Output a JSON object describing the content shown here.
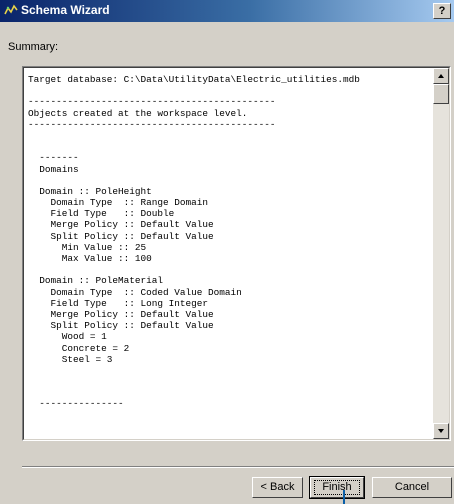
{
  "window": {
    "title": "Schema Wizard",
    "help_label": "?"
  },
  "summary_label": "Summary:",
  "summary_lines": [
    "Target database: C:\\Data\\UtilityData\\Electric_utilities.mdb",
    "",
    "--------------------------------------------",
    "Objects created at the workspace level.",
    "--------------------------------------------",
    "",
    "",
    "  -------",
    "  Domains",
    "",
    "  Domain :: PoleHeight",
    "    Domain Type  :: Range Domain",
    "    Field Type   :: Double",
    "    Merge Policy :: Default Value",
    "    Split Policy :: Default Value",
    "      Min Value :: 25",
    "      Max Value :: 100",
    "",
    "  Domain :: PoleMaterial",
    "    Domain Type  :: Coded Value Domain",
    "    Field Type   :: Long Integer",
    "    Merge Policy :: Default Value",
    "    Split Policy :: Default Value",
    "      Wood = 1",
    "      Concrete = 2",
    "      Steel = 3",
    "",
    "",
    "",
    "  ---------------"
  ],
  "buttons": {
    "back": "< Back",
    "finish": "Finish",
    "cancel": "Cancel"
  }
}
